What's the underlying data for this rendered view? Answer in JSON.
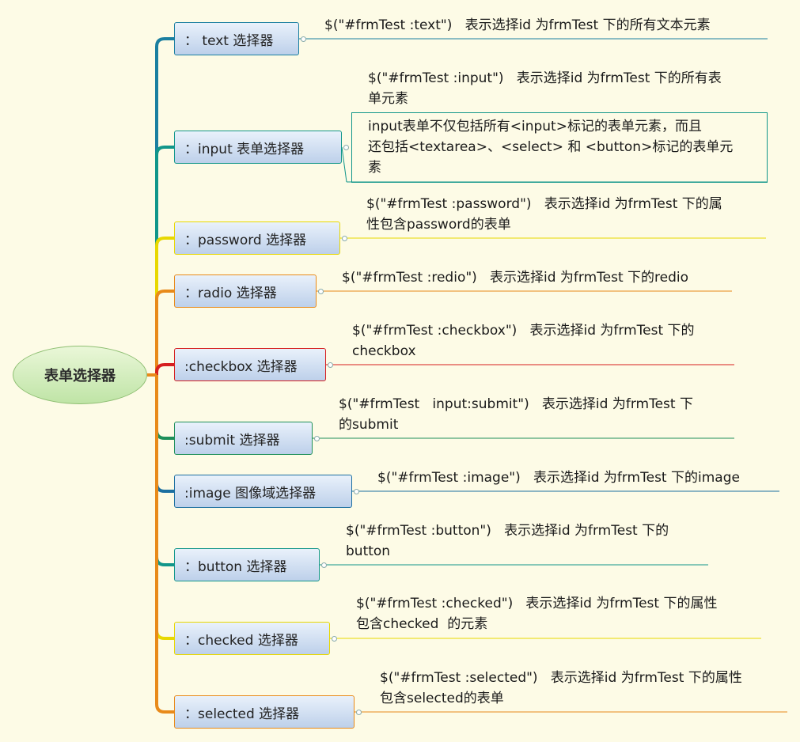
{
  "root": {
    "label": "表单选择器"
  },
  "branches": [
    {
      "id": "text",
      "label": "：  text 选择器",
      "color": "#1b7fa0",
      "desc": "$(\"#frmTest :text\")   表示选择id 为frmTest 下的所有文本元素"
    },
    {
      "id": "input",
      "label": "：input  表单选择器",
      "color": "#11968a",
      "desc": "$(\"#frmTest :input\")   表示选择id 为frmTest 下的所有表\n单元素",
      "note": "input表单不仅包括所有<input>标记的表单元素，而且\n还包括<textarea>、<select> 和 <button>标记的表单元\n素"
    },
    {
      "id": "password",
      "label": "：password  选择器",
      "color": "#e8d800",
      "desc": "$(\"#frmTest :password\")   表示选择id 为frmTest 下的属\n性包含password的表单"
    },
    {
      "id": "radio",
      "label": "：radio  选择器",
      "color": "#e88a1a",
      "desc": "$(\"#frmTest :redio\")   表示选择id 为frmTest 下的redio"
    },
    {
      "id": "checkbox",
      "label": ":checkbox  选择器",
      "color": "#d61f1f",
      "desc": "$(\"#frmTest :checkbox\")   表示选择id 为frmTest 下的\ncheckbox"
    },
    {
      "id": "submit",
      "label": ":submit   选择器",
      "color": "#1e8f5a",
      "desc": "$(\"#frmTest   input:submit\")   表示选择id 为frmTest 下\n的submit"
    },
    {
      "id": "image",
      "label": ":image  图像域选择器",
      "color": "#1c6fa0",
      "desc": "$(\"#frmTest :image\")   表示选择id 为frmTest 下的image"
    },
    {
      "id": "button",
      "label": "：button  选择器",
      "color": "#11968a",
      "desc": "$(\"#frmTest :button\")   表示选择id 为frmTest 下的\nbutton"
    },
    {
      "id": "checked",
      "label": "：checked  选择器",
      "color": "#e8d800",
      "desc": "$(\"#frmTest :checked\")   表示选择id 为frmTest 下的属性\n包含checked  的元素"
    },
    {
      "id": "selected",
      "label": "：selected  选择器",
      "color": "#e88a1a",
      "desc": "$(\"#frmTest :selected\")   表示选择id 为frmTest 下的属性\n包含selected的表单"
    }
  ]
}
